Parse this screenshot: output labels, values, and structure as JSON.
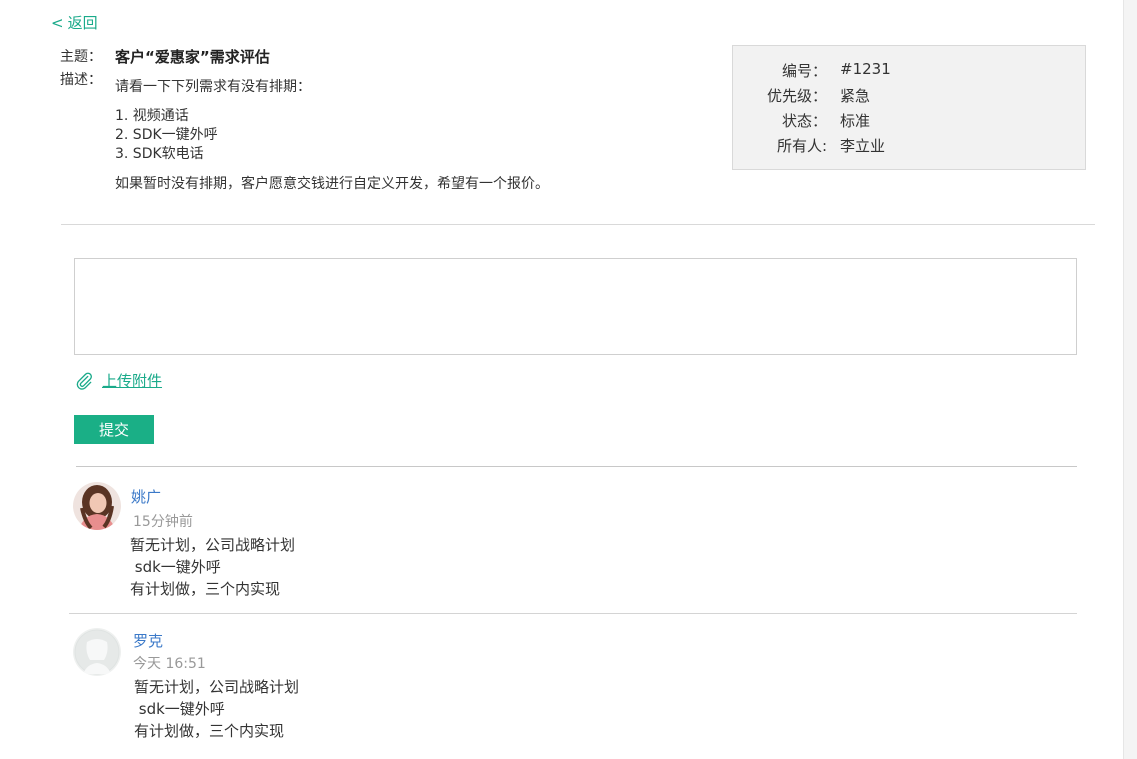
{
  "nav": {
    "back_chevron": "<",
    "back_label": "返回"
  },
  "ticket": {
    "subject_label": "主题：",
    "subject": "客户“爱惠家”需求评估",
    "desc_label": "描述：",
    "desc_intro": "请看一下下列需求有没有排期：",
    "desc_items": [
      "1. 视频通话",
      "2. SDK一键外呼",
      "3. SDK软电话"
    ],
    "desc_outro": "如果暂时没有排期，客户愿意交钱进行自定义开发，希望有一个报价。"
  },
  "info": {
    "id_label": "编号：",
    "id": "#1231",
    "priority_label": "优先级：",
    "priority": "紧急",
    "status_label": "状态：",
    "status": "标准",
    "owner_label": "所有人:",
    "owner": "李立业"
  },
  "reply": {
    "value": "",
    "placeholder": ""
  },
  "attach": {
    "icon": "paperclip-icon",
    "label": "上传附件"
  },
  "submit_label": "提交",
  "comments": [
    {
      "avatar": "user-photo-woman",
      "name": "姚广",
      "time": "15分钟前",
      "lines": [
        "暂无计划，公司战略计划",
        " sdk一键外呼",
        "有计划做，三个内实现"
      ]
    },
    {
      "avatar": "default-avatar-icon",
      "name": "罗克",
      "time": "今天 16:51",
      "lines": [
        "暂无计划，公司战略计划",
        " sdk一键外呼",
        "有计划做，三个内实现"
      ]
    }
  ],
  "colors": {
    "accent": "#1aaf86",
    "link": "#1aaa8a",
    "name": "#3b79c8",
    "muted": "#999999"
  }
}
